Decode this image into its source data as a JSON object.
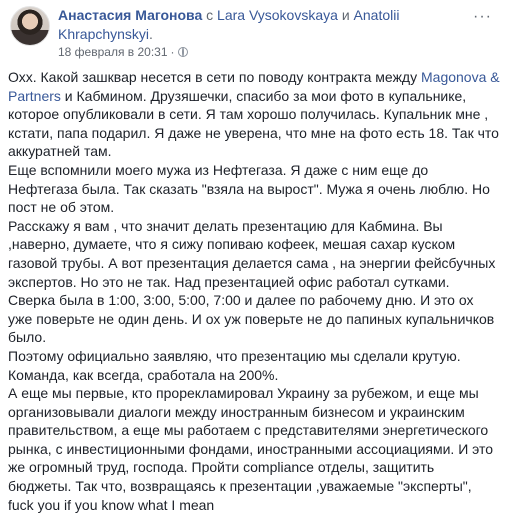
{
  "post": {
    "author": "Анастасия Магонова",
    "with_prefix": "с",
    "tag1": "Lara Vysokovskaya",
    "and_word": "и",
    "tag2": "Anatolii Khrapchynskyi",
    "tag_end": ".",
    "date": "18 февраля в 20:31",
    "privacy_icon": "globe-icon",
    "menu_icon": "more-options-icon",
    "menu_label": "···"
  },
  "text": {
    "p1_a": "Охх. Какой зашквар несется в сети по поводу контракта между ",
    "p1_link": "Magonova & Partners",
    "p1_b": " и Кабмином. Друзяшечки, спасибо за мои фото в купальнике, которое опубликовали в сети. Я там хорошо получилась. Купальник мне , кстати, папа подарил. Я даже не уверена, что мне на фото есть 18. Так что аккуратней там.",
    "p2": "Еще вспомнили моего мужа из Нефтегаза. Я даже с ним еще до Нефтегаза была. Так сказать \"взяла на вырост\". Мужа я очень люблю. Но пост не об этом.",
    "p3": "Расскажу я вам , что значит делать презентацию для Кабмина. Вы ,наверно, думаете, что я сижу попиваю кофеек, мешая сахар куском газовой трубы. А вот презентация делается сама , на энергии фейсбучных экспертов. Но это не так. Над презентацией офис работал сутками. Сверка была в 1:00, 3:00, 5:00, 7:00 и далее по рабочему дню. И это ох уже поверьте не один день. И ох уж поверьте не до папиных купальничков было.",
    "p4": "Поэтому официально заявляю, что презентацию мы сделали крутую. Команда, как всегда, сработала на 200%.",
    "p5": "А еще мы первые, кто прорекламировал Украину за рубежом, и еще мы организовывали диалоги между иностранным бизнесом и украинским правительством, а еще мы работаем с представителями энергетического рынка, с инвестиционными фондами, иностранными ассоциациями. И это же огромный труд, господа. Пройти compliance отделы, защитить бюджеты. Так что, возвращаясь к презентации ,уважаемые \"эксперты\", fuck you if you know what I mean"
  }
}
